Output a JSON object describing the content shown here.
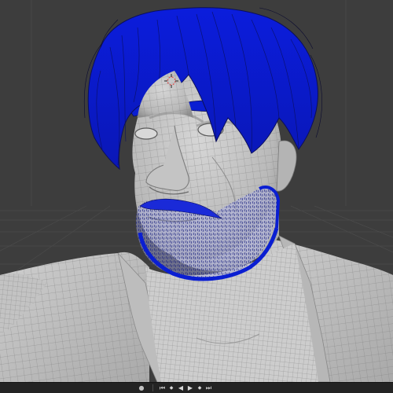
{
  "viewport": {
    "background_color": "#3d3d3d",
    "grid_color": "#4b4b4b",
    "mesh_color": "#c9c9c9",
    "wire_color": "#7a7a7a",
    "hair_color": "#0a1ed2",
    "hair_stroke_color": "#0b0f5a",
    "beard_color": "#1a2ad8",
    "origin_marker_color": "#e05050"
  },
  "timeline": {
    "icons": [
      {
        "name": "record-icon",
        "glyph": "●"
      },
      {
        "name": "jump-to-start-icon",
        "glyph": "⏮"
      },
      {
        "name": "previous-keyframe-icon",
        "glyph": "◆"
      },
      {
        "name": "play-reverse-icon",
        "glyph": "◀"
      },
      {
        "name": "play-icon",
        "glyph": "▶"
      },
      {
        "name": "next-keyframe-icon",
        "glyph": "◆"
      },
      {
        "name": "jump-to-end-icon",
        "glyph": "⏭"
      }
    ]
  }
}
